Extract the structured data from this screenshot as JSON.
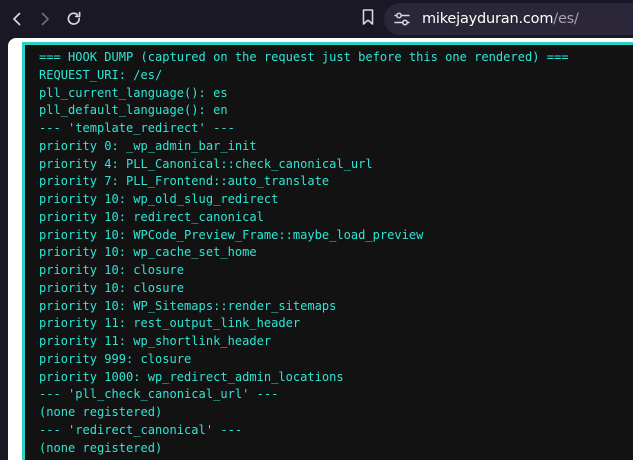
{
  "browser": {
    "url_host": "mikejayduran.com",
    "url_path": "/es/",
    "icons": {
      "back": "arrow-left-icon",
      "forward": "arrow-right-icon",
      "reload": "reload-icon",
      "bookmark": "bookmark-icon",
      "site_info": "site-settings-icon"
    }
  },
  "colors": {
    "chrome_bg": "#1b1825",
    "urlbar_bg": "#2b2738",
    "panel_bg": "#121212",
    "panel_border": "#2ad1c4",
    "dump_text": "#2ee6d6"
  },
  "dump": {
    "lines": [
      "=== HOOK DUMP (captured on the request just before this one rendered) ===",
      "REQUEST_URI: /es/",
      "pll_current_language(): es",
      "pll_default_language(): en",
      "--- 'template_redirect' ---",
      "priority 0: _wp_admin_bar_init",
      "priority 4: PLL_Canonical::check_canonical_url",
      "priority 7: PLL_Frontend::auto_translate",
      "priority 10: wp_old_slug_redirect",
      "priority 10: redirect_canonical",
      "priority 10: WPCode_Preview_Frame::maybe_load_preview",
      "priority 10: wp_cache_set_home",
      "priority 10: closure",
      "priority 10: closure",
      "priority 10: WP_Sitemaps::render_sitemaps",
      "priority 11: rest_output_link_header",
      "priority 11: wp_shortlink_header",
      "priority 999: closure",
      "priority 1000: wp_redirect_admin_locations",
      "--- 'pll_check_canonical_url' ---",
      "(none registered)",
      "--- 'redirect_canonical' ---",
      "(none registered)"
    ]
  }
}
